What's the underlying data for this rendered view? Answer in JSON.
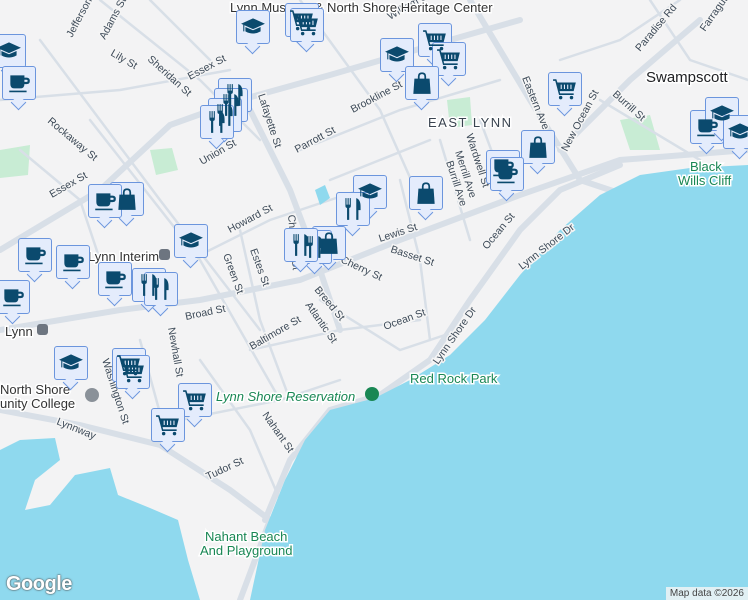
{
  "colors": {
    "water": "#8fd9ee",
    "land": "#f3f3f4",
    "road": "#d8dfe7",
    "park": "#c8ecd4",
    "marker_bg": "#e4ecfc",
    "marker_border": "#6b95dd",
    "icon": "#0b4a6e"
  },
  "places": {
    "swampscott": "Swampscott",
    "east_lynn": "EAST LYNN",
    "lynn": "Lynn",
    "lynn_interim": "Lynn Interim",
    "black_wills_cliff_1": "Black",
    "black_wills_cliff_2": "Wills Cliff",
    "red_rock_park": "Red Rock Park",
    "lynn_shore_reservation": "Lynn Shore Reservation",
    "nahant_beach_1": "Nahant Beach",
    "nahant_beach_2": "And Playground",
    "college_1": "North Shore",
    "college_2": "unity College",
    "museum": "Lynn Museum & North Shore Heritage Center"
  },
  "streets": [
    "Essex St",
    "Essex St",
    "Union St",
    "Lily St",
    "Sheridan St",
    "Rockaway St",
    "Jefferson St",
    "Adams St",
    "Parrott St",
    "Brookline St",
    "Howard St",
    "Green St",
    "Estes St",
    "Chatham St",
    "Lewis St",
    "Cherry St",
    "Basset St",
    "Broad St",
    "Breed St",
    "Atlantic St",
    "Baltimore St",
    "Ocean St",
    "Ocean St",
    "Lynn Shore Dr",
    "Lynn Shore Dr",
    "Eastern Ave",
    "New Ocean St",
    "Burrill St",
    "Paradise Rd",
    "Farragut Rd",
    "Merrill Ave",
    "Burrill Ave",
    "Wardwell St",
    "Newhall St",
    "Washington St",
    "Nahant St",
    "Tudor St",
    "Lynnway",
    "Lafayette St",
    "William St"
  ],
  "markers": [
    "school-icon",
    "coffee-icon",
    "school-icon",
    "cart-icon",
    "cart-icon",
    "restaurant-icon",
    "restaurant-icon",
    "restaurant-icon",
    "restaurant-icon",
    "school-icon",
    "cart-icon",
    "cart-icon",
    "bag-icon",
    "cart-icon",
    "coffee-icon",
    "coffee-icon",
    "bag-icon",
    "school-icon",
    "coffee-icon",
    "school-icon",
    "school-icon",
    "restaurant-icon",
    "bag-icon",
    "bag-icon",
    "coffee-icon",
    "school-icon",
    "bag-icon",
    "restaurant-icon",
    "restaurant-icon",
    "coffee-icon",
    "coffee-icon",
    "coffee-icon",
    "coffee-icon",
    "restaurant-icon",
    "restaurant-icon",
    "school-icon",
    "cart-icon",
    "cart-icon",
    "cart-icon",
    "cart-icon"
  ],
  "branding": {
    "logo": "Google",
    "attribution": "Map data ©2026"
  }
}
